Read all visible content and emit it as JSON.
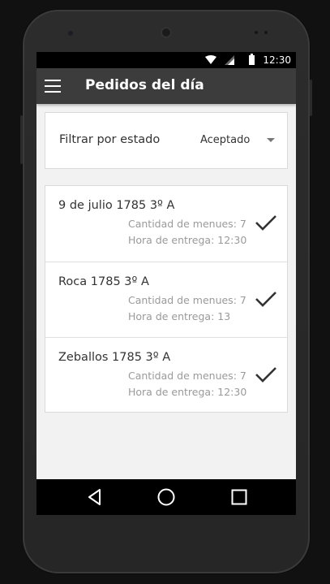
{
  "statusbar": {
    "time": "12:30",
    "icons": [
      "wifi-icon",
      "signal-icon",
      "battery-icon"
    ]
  },
  "toolbar": {
    "menu_icon": "hamburger-menu-icon",
    "title": "Pedidos del día"
  },
  "filter": {
    "label": "Filtrar por estado",
    "selected": "Aceptado"
  },
  "orders": [
    {
      "address": "9 de julio 1785 3º A",
      "quantity": "Cantidad de menues: 7",
      "delivery": "Hora de entrega: 12:30",
      "status_icon": "checkmark-icon"
    },
    {
      "address": "Roca 1785 3º A",
      "quantity": "Cantidad de menues: 7",
      "delivery": "Hora de entrega: 13",
      "status_icon": "checkmark-icon"
    },
    {
      "address": "Zeballos 1785 3º A",
      "quantity": "Cantidad de menues: 7",
      "delivery": "Hora de entrega: 12:30",
      "status_icon": "checkmark-icon"
    }
  ],
  "navbar": {
    "icons": [
      "back-icon",
      "home-icon",
      "recents-icon"
    ]
  },
  "colors": {
    "toolbar": "#3c3c3c",
    "background": "#f2f2f2",
    "card": "#ffffff",
    "primary_text": "#333333",
    "secondary_text": "#9a9a9a"
  }
}
